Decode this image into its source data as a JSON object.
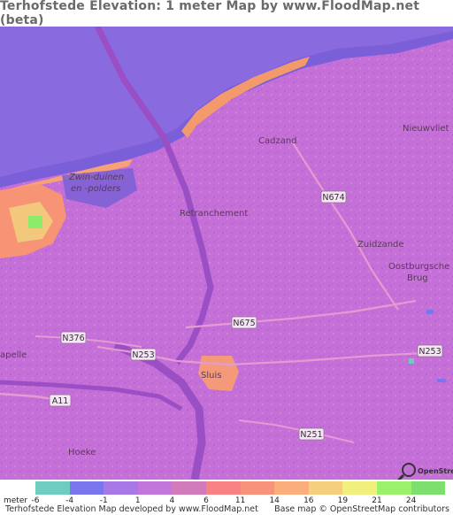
{
  "title": "Terhofstede Elevation: 1 meter Map by www.FloodMap.net (beta)",
  "map": {
    "places": {
      "cadzand": "Cadzand",
      "nieuwvliet": "Nieuwvliet",
      "retranchement": "Retranchement",
      "zuidzande": "Zuidzande",
      "oostburgsche_1": "Oostburgsche",
      "oostburgsche_2": "Brug",
      "sluis": "Sluis",
      "hoeke": "Hoeke",
      "kapelle": "apelle",
      "zwin_1": "Zwin-duinen",
      "zwin_2": "en -polders"
    },
    "roads": {
      "n674": "N674",
      "n675": "N675",
      "n376": "N376",
      "n253_a": "N253",
      "n253_b": "N253",
      "a11": "A11",
      "n251": "N251"
    },
    "osm_logo": "OpenStreetMap"
  },
  "legend": {
    "unit_prefix": "meter",
    "colors": [
      "#6ecdc0",
      "#7a76ee",
      "#a879e6",
      "#c276dc",
      "#d27bbb",
      "#f78183",
      "#f9927a",
      "#f9ae7c",
      "#f6cf7c",
      "#f2f07c",
      "#9cf16a",
      "#7de06e"
    ],
    "ticks": [
      "-6",
      "-4",
      "-1",
      "1",
      "4",
      "6",
      "11",
      "14",
      "16",
      "19",
      "21",
      "24"
    ]
  },
  "footer": {
    "left": "Terhofstede Elevation Map developed by www.FloodMap.net",
    "right": "Base map © OpenStreetMap contributors"
  }
}
